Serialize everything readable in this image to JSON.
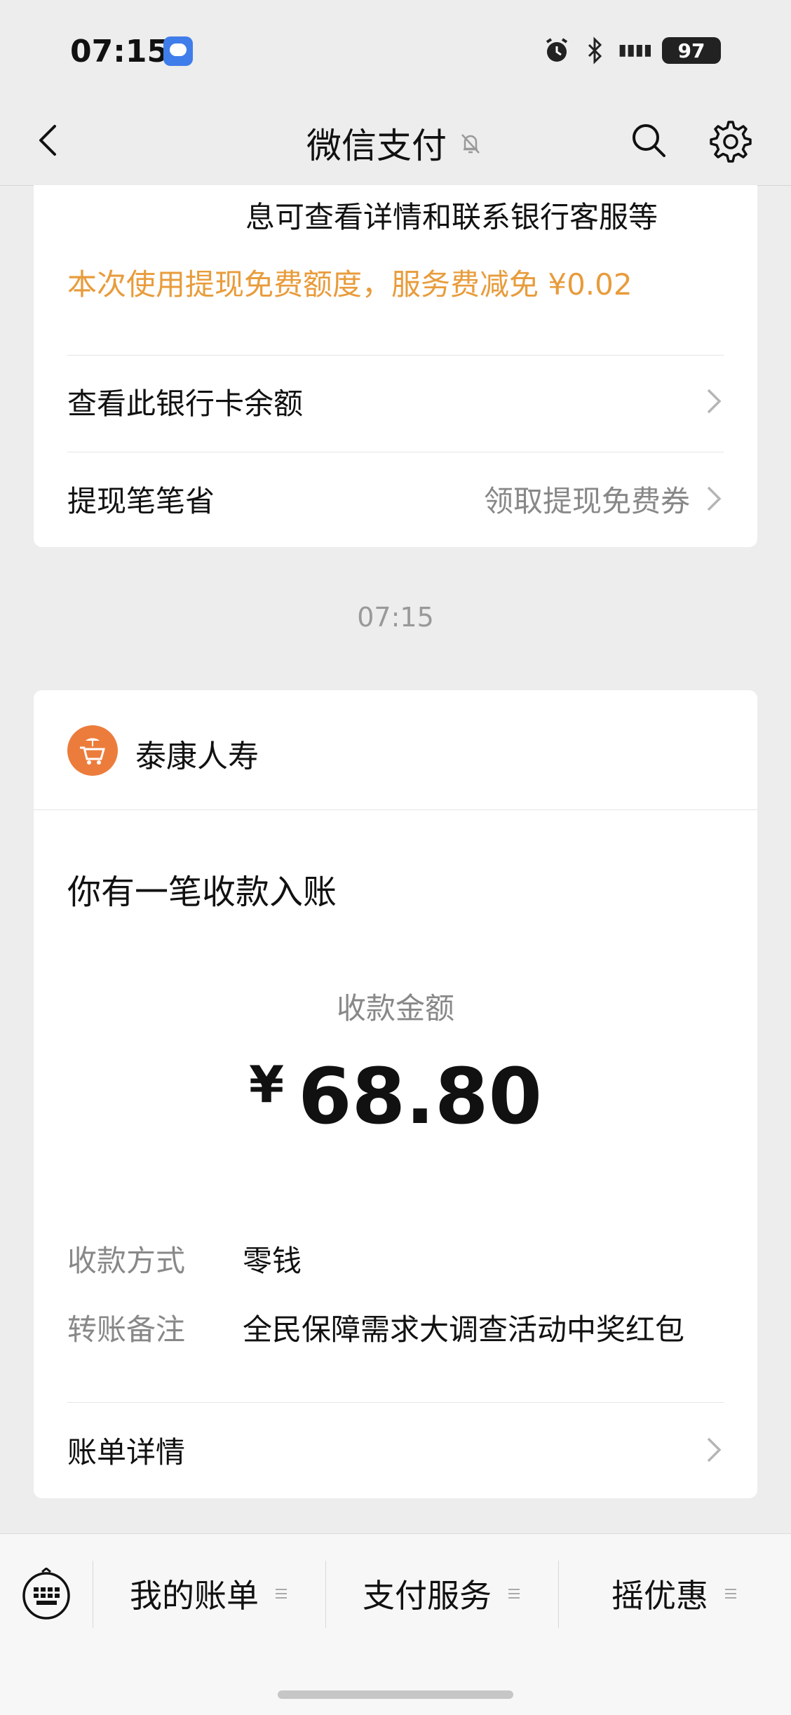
{
  "status_bar": {
    "time": "07:15",
    "signal_text": "5A\n5A",
    "battery": "97",
    "icons": [
      "message-icon",
      "alarm-icon",
      "bluetooth-icon",
      "signal-icon",
      "battery-icon"
    ]
  },
  "nav": {
    "title": "微信支付",
    "icons": [
      "back-icon",
      "mute-bell-icon",
      "search-icon",
      "gear-icon"
    ]
  },
  "card1": {
    "partial_text": "息可查看详情和联系银行客服等",
    "promo_text": "本次使用提现免费额度，服务费减免 ¥0.02",
    "rows": [
      {
        "label": "查看此银行卡余额",
        "value": ""
      },
      {
        "label": "提现笔笔省",
        "value": "领取提现免费券"
      }
    ]
  },
  "timestamp": "07:15",
  "card2": {
    "brand_name": "泰康人寿",
    "notice": "你有一笔收款入账",
    "amount_label": "收款金额",
    "currency": "¥",
    "amount": "68.80",
    "details": [
      {
        "key": "收款方式",
        "value": "零钱"
      },
      {
        "key": "转账备注",
        "value": "全民保障需求大调查活动中奖红包"
      }
    ],
    "bill_details_label": "账单详情"
  },
  "tabbar": {
    "tabs": [
      "我的账单",
      "支付服务",
      "摇优惠"
    ]
  },
  "colors": {
    "background": "#ededed",
    "promo": "#e89c3c",
    "brand": "#ec7c3c"
  }
}
